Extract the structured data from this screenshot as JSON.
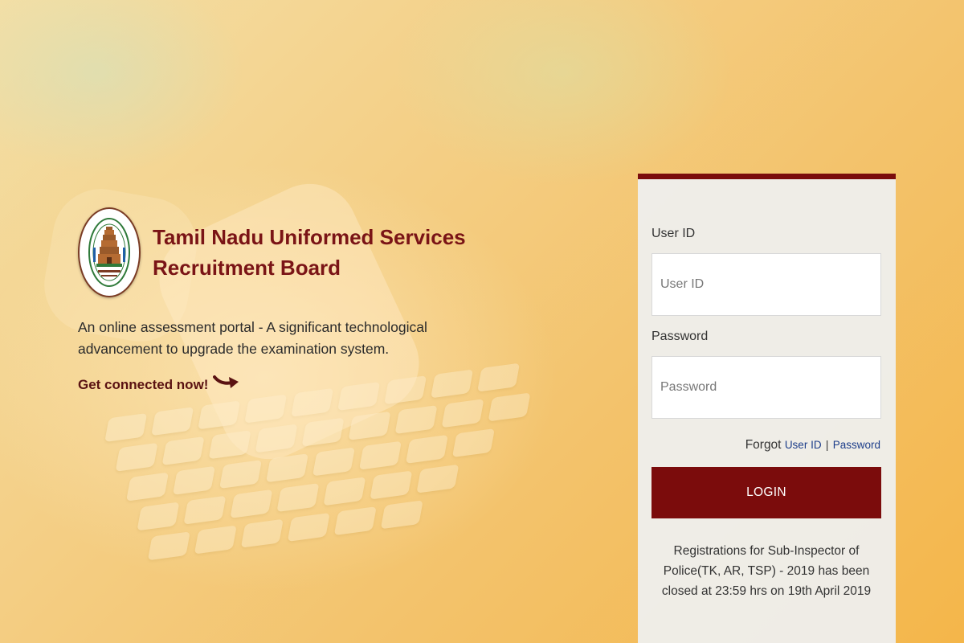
{
  "branding": {
    "title_line1": "Tamil Nadu Uniformed Services",
    "title_line2": "Recruitment Board",
    "emblem_icon": "tamil-nadu-emblem-icon"
  },
  "intro": {
    "tagline": "An online assessment portal - A significant technological advancement to upgrade the examination system.",
    "cta_text": "Get connected now!",
    "cta_icon": "curved-arrow-right-icon"
  },
  "login": {
    "user_id_label": "User ID",
    "user_id_placeholder": "User ID",
    "user_id_value": "",
    "password_label": "Password",
    "password_placeholder": "Password",
    "password_value": "",
    "forgot_text": "Forgot",
    "forgot_user_id_link": "User ID",
    "forgot_separator": "|",
    "forgot_password_link": "Password",
    "login_button": "LOGIN",
    "notice": "Registrations for Sub-Inspector of Police(TK, AR, TSP) - 2019 has been closed at 23:59 hrs on 19th April 2019"
  },
  "colors": {
    "brand_maroon": "#7b0c0c",
    "title_maroon": "#7a1416",
    "link_blue": "#1c3d8a",
    "panel_bg": "#eeeeec",
    "background_orange": "#f4b64a"
  }
}
